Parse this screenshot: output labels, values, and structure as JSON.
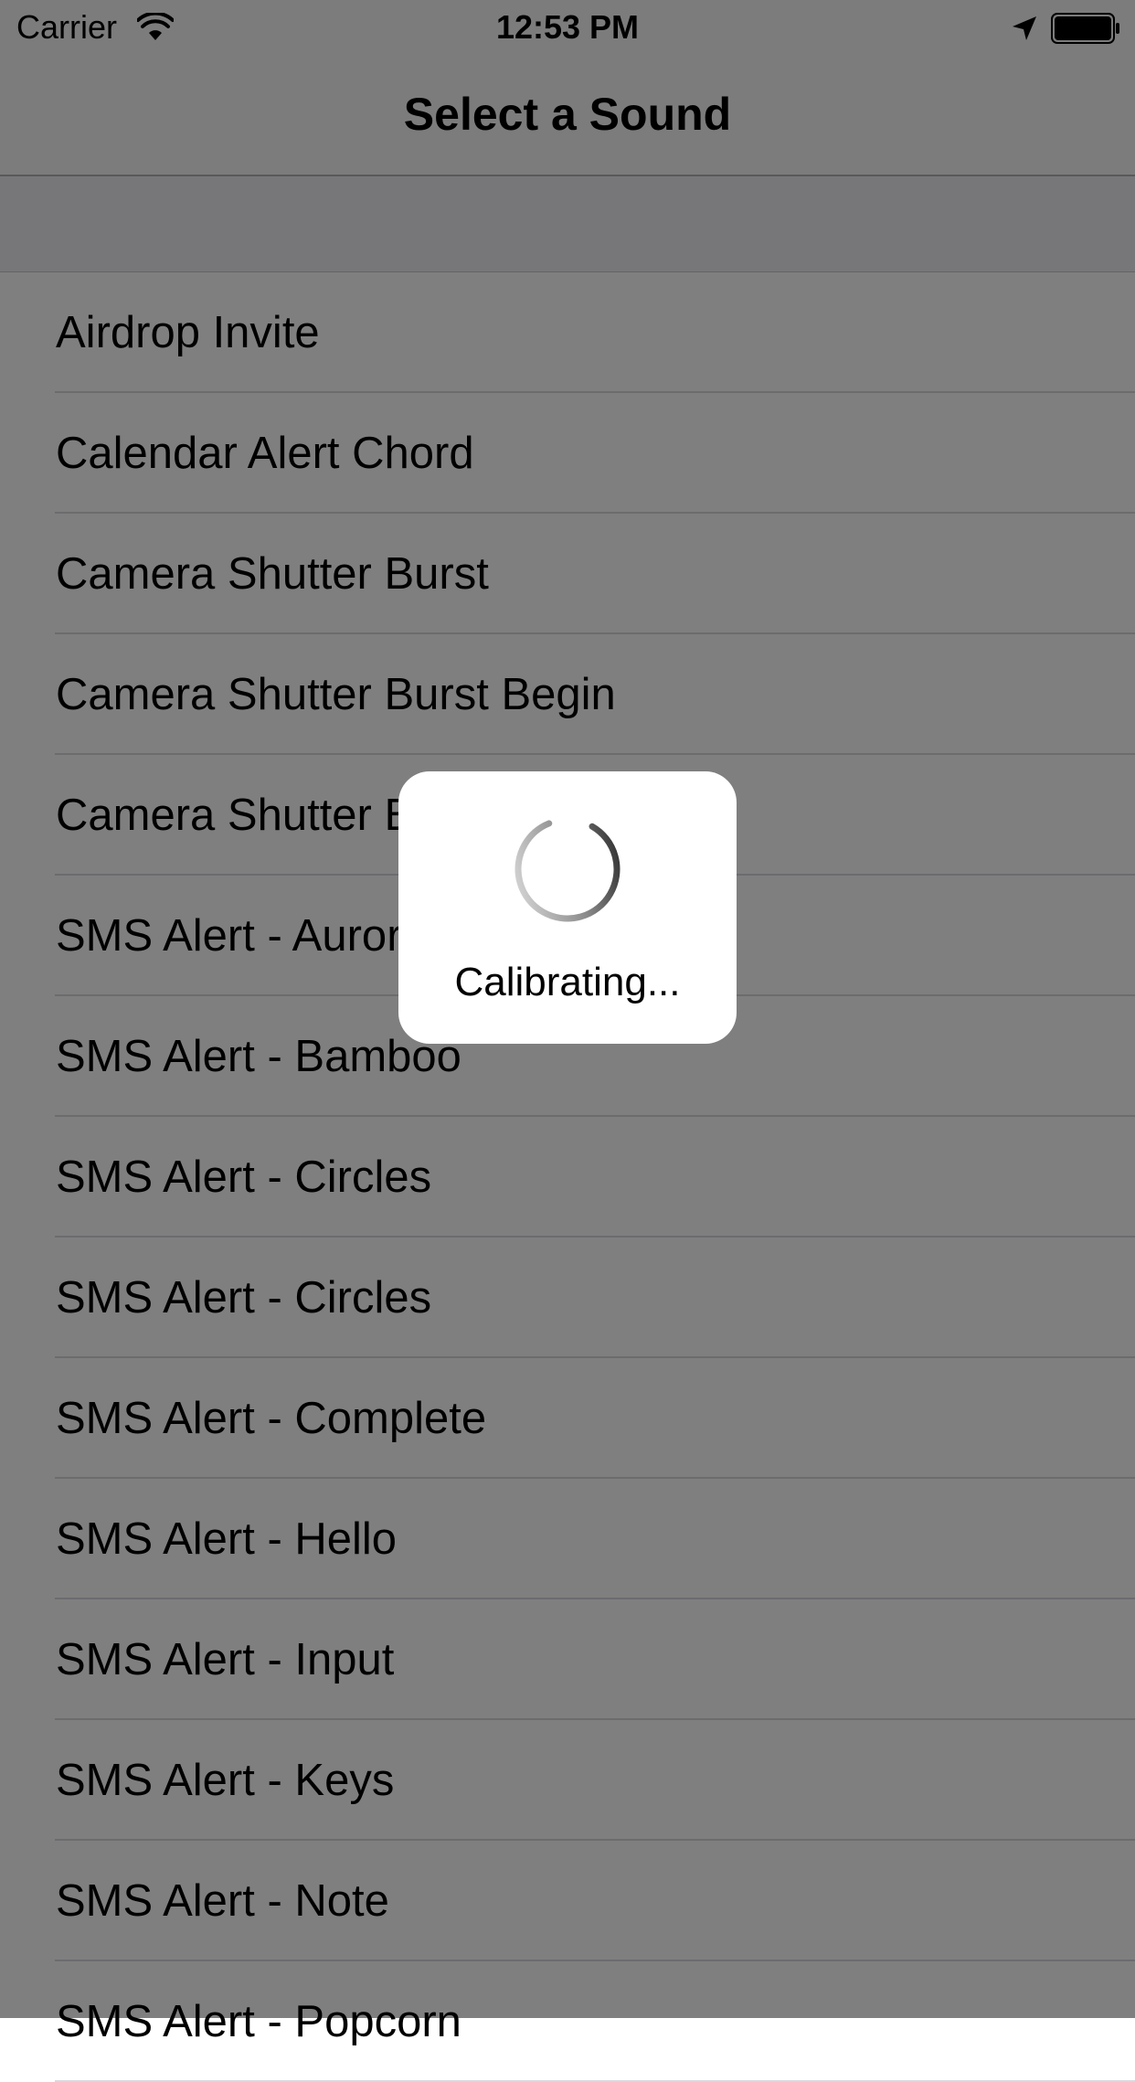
{
  "status_bar": {
    "carrier": "Carrier",
    "time": "12:53 PM",
    "icons": [
      "wifi-icon",
      "location-icon",
      "battery-icon"
    ]
  },
  "nav": {
    "title": "Select a Sound"
  },
  "sounds": [
    "Airdrop Invite",
    "Calendar Alert Chord",
    "Camera Shutter Burst",
    "Camera Shutter Burst Begin",
    "Camera Shutter Burst End",
    "SMS Alert - Aurora",
    "SMS Alert - Bamboo",
    "SMS Alert - Circles",
    "SMS Alert - Circles",
    "SMS Alert - Complete",
    "SMS Alert - Hello",
    "SMS Alert - Input",
    "SMS Alert - Keys",
    "SMS Alert - Note",
    "SMS Alert - Popcorn"
  ],
  "hud": {
    "label": "Calibrating...",
    "icon": "spinner-icon"
  },
  "colors": {
    "overlay": "rgba(0,0,0,0.5)",
    "hud_background": "#ffffff",
    "separator": "#d9d9de"
  }
}
